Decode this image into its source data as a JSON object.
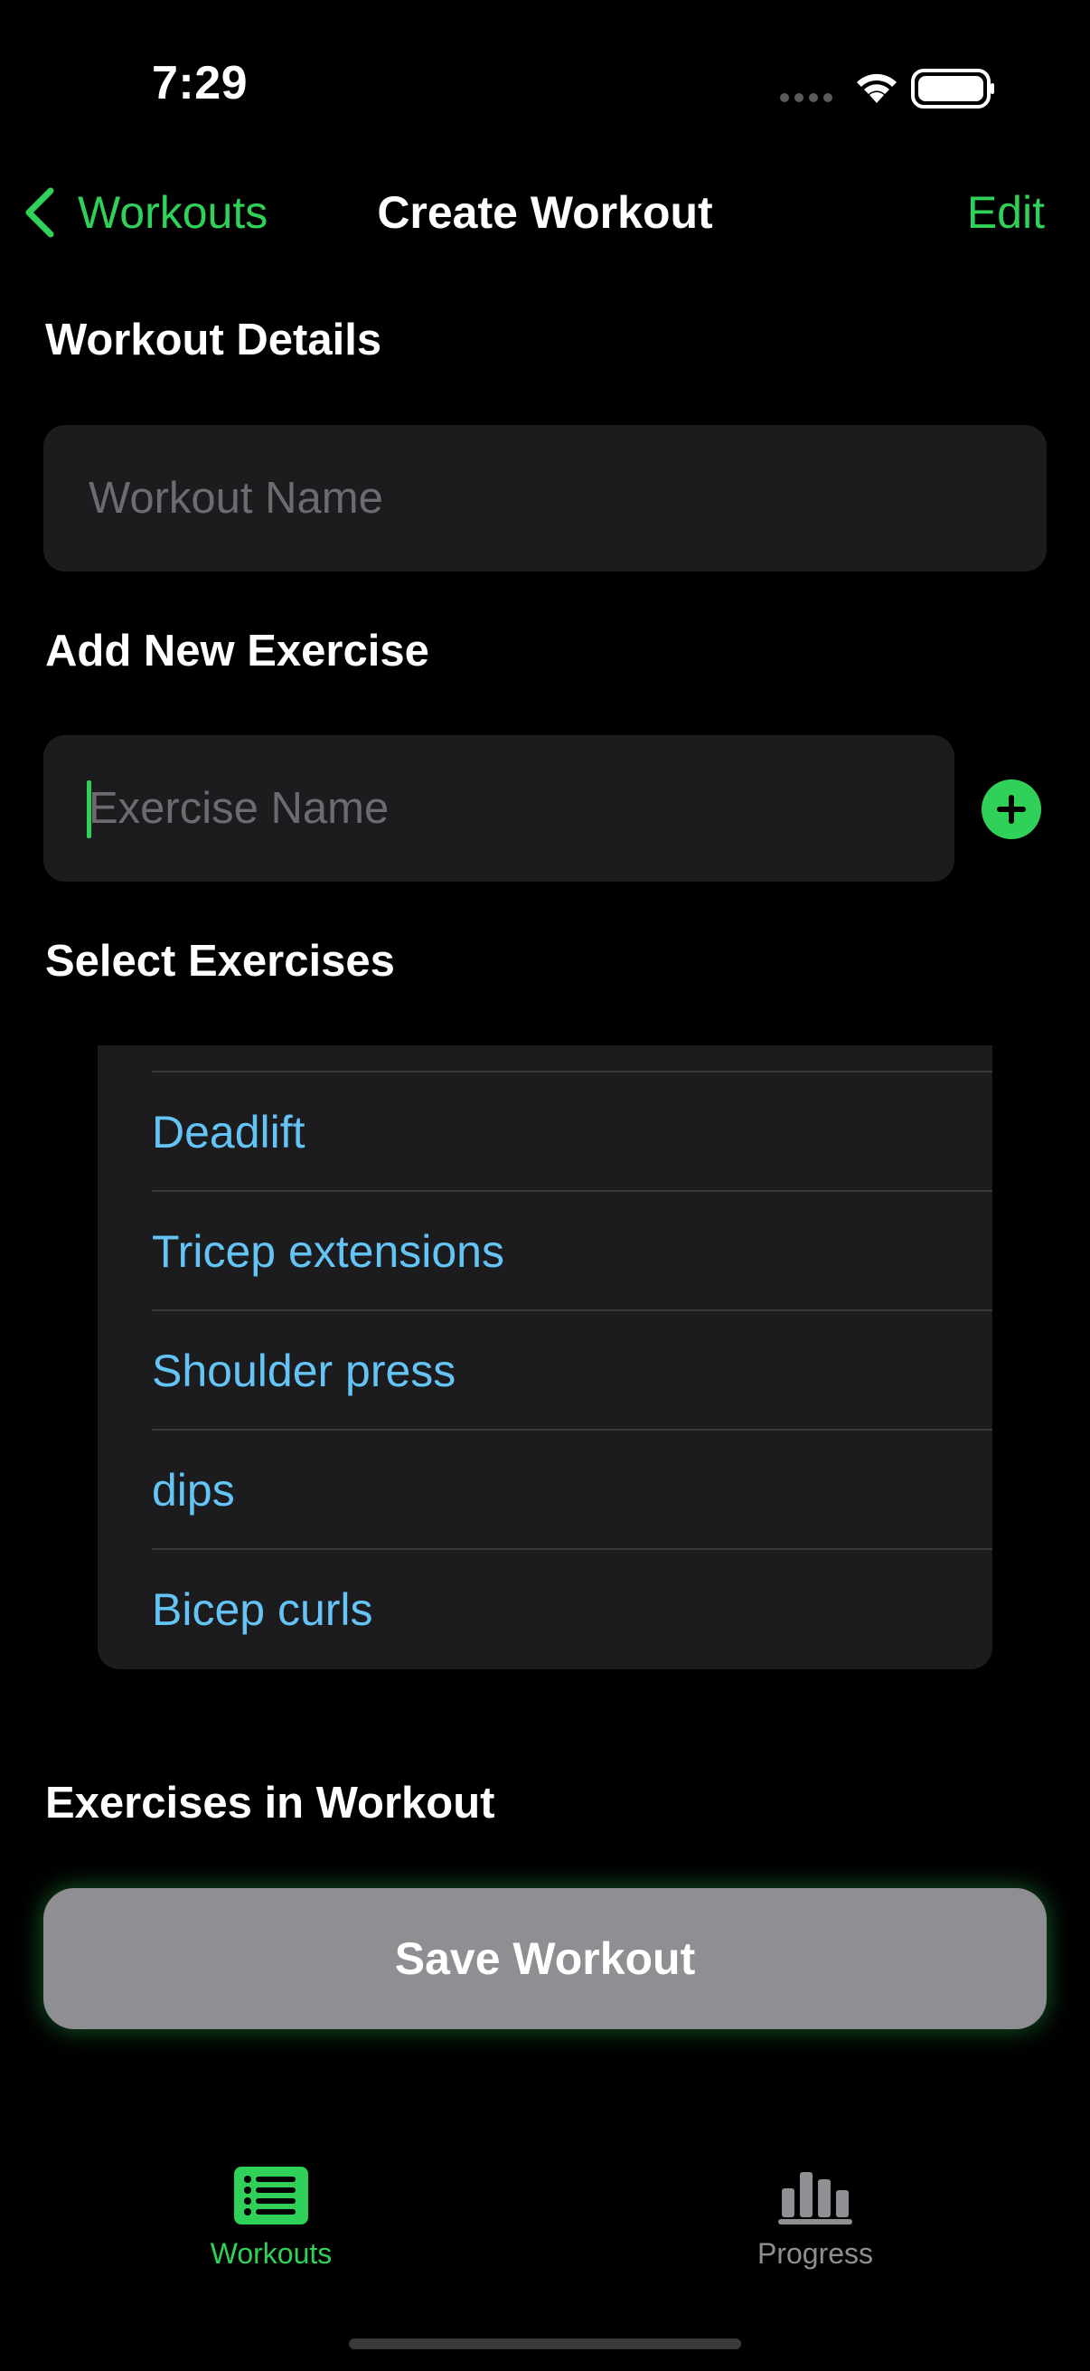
{
  "status_bar": {
    "time": "7:29"
  },
  "nav": {
    "back_label": "Workouts",
    "title": "Create Workout",
    "edit_label": "Edit"
  },
  "workout_details": {
    "heading": "Workout Details",
    "name_placeholder": "Workout Name",
    "name_value": ""
  },
  "add_exercise": {
    "heading": "Add New Exercise",
    "name_placeholder": "Exercise Name",
    "name_value": ""
  },
  "select_exercises": {
    "heading": "Select Exercises",
    "items": [
      {
        "label": "Deadlift"
      },
      {
        "label": "Tricep extensions"
      },
      {
        "label": "Shoulder press"
      },
      {
        "label": "dips"
      },
      {
        "label": "Bicep curls"
      }
    ]
  },
  "exercises_in_workout": {
    "heading": "Exercises in Workout"
  },
  "save_button": {
    "label": "Save Workout"
  },
  "tab_bar": {
    "tabs": [
      {
        "label": "Workouts",
        "icon": "list-icon",
        "selected": true
      },
      {
        "label": "Progress",
        "icon": "chart-bar-icon",
        "selected": false
      }
    ]
  },
  "colors": {
    "accent": "#30D158",
    "link": "#64C4F5",
    "background": "#000000",
    "surface": "#1C1C1E",
    "inactive": "#8E8E93"
  }
}
